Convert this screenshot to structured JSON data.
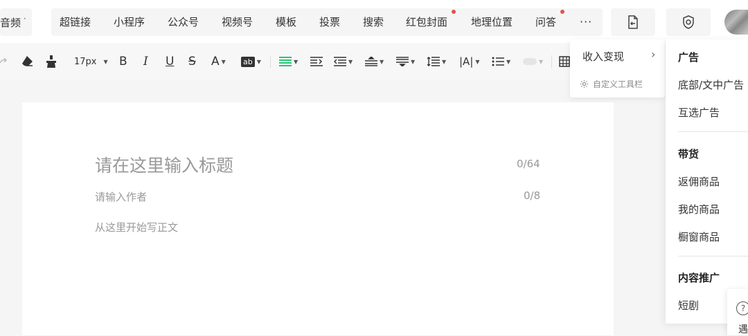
{
  "topbar": {
    "audio_tab": "音频",
    "insert_items": [
      {
        "label": "超链接"
      },
      {
        "label": "小程序"
      },
      {
        "label": "公众号"
      },
      {
        "label": "视频号"
      },
      {
        "label": "模板"
      },
      {
        "label": "投票"
      },
      {
        "label": "搜索"
      },
      {
        "label": "红包封面",
        "badge": true
      },
      {
        "label": "地理位置"
      },
      {
        "label": "问答",
        "badge": true
      }
    ],
    "more_label": "···"
  },
  "toolbar": {
    "font_size": "17px",
    "bold": "B",
    "italic": "I",
    "underline": "U",
    "strike": "S",
    "font_color": "A",
    "bg_color": "ab",
    "letter_spacing": "|A|"
  },
  "editor": {
    "title_placeholder": "请在这里输入标题",
    "title_count": "0/64",
    "author_placeholder": "请输入作者",
    "author_count": "0/8",
    "body_placeholder": "从这里开始写正文"
  },
  "menu_left": {
    "monetize": "收入变现",
    "customize_toolbar": "自定义工具栏"
  },
  "menu_right": {
    "ads_title": "广告",
    "ads_items": [
      "底部/文中广告",
      "互选广告"
    ],
    "goods_title": "带货",
    "goods_items": [
      "返佣商品",
      "我的商品",
      "橱窗商品"
    ],
    "promo_title": "内容推广",
    "promo_items": [
      "短剧"
    ]
  },
  "help": {
    "icon": "?",
    "label": "遇"
  },
  "colors": {
    "accent": "#07c160",
    "badge": "#e65050",
    "placeholder": "#999999"
  }
}
